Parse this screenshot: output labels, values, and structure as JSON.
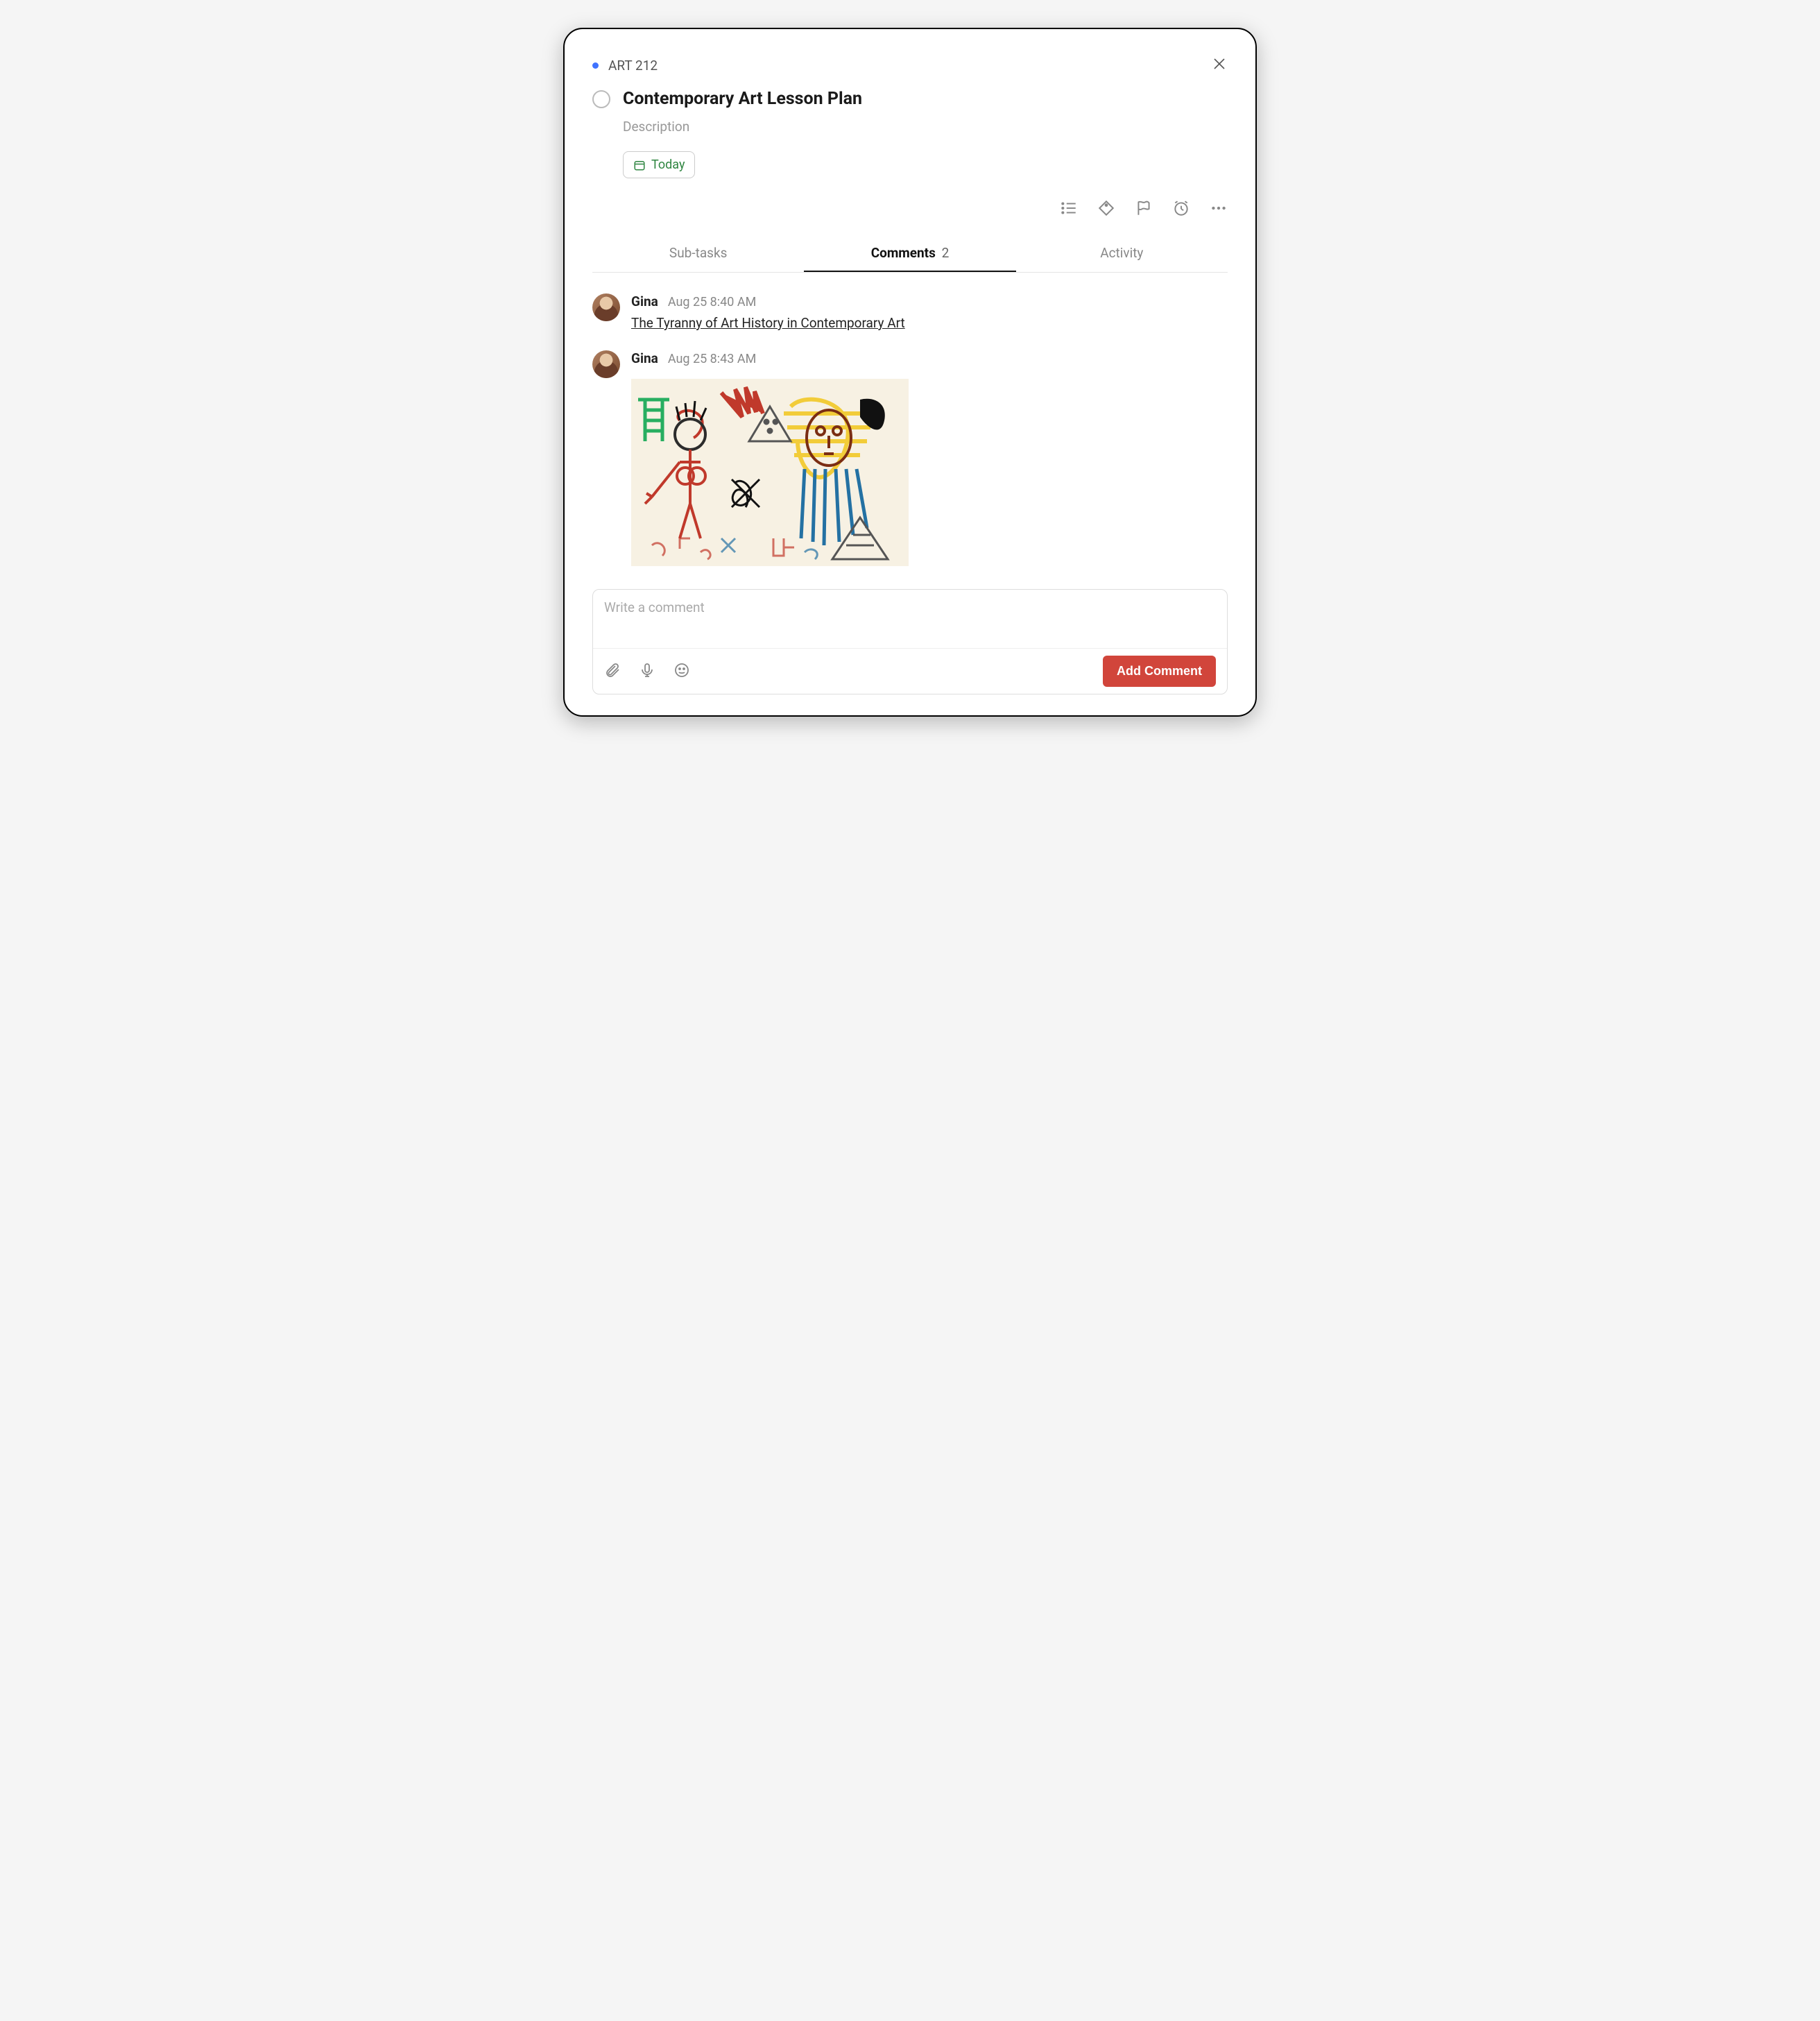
{
  "breadcrumb": {
    "project": "ART 212"
  },
  "task": {
    "title": "Contemporary Art Lesson Plan",
    "description_placeholder": "Description",
    "date_label": "Today"
  },
  "tabs": {
    "subtasks": "Sub-tasks",
    "comments": "Comments",
    "comments_count": "2",
    "activity": "Activity"
  },
  "comments": [
    {
      "author": "Gina",
      "time": "Aug 25 8:40 AM",
      "link_text": "The Tyranny of Art History in Contemporary Art"
    },
    {
      "author": "Gina",
      "time": "Aug 25 8:43 AM"
    }
  ],
  "composer": {
    "placeholder": "Write a comment",
    "button": "Add Comment"
  }
}
